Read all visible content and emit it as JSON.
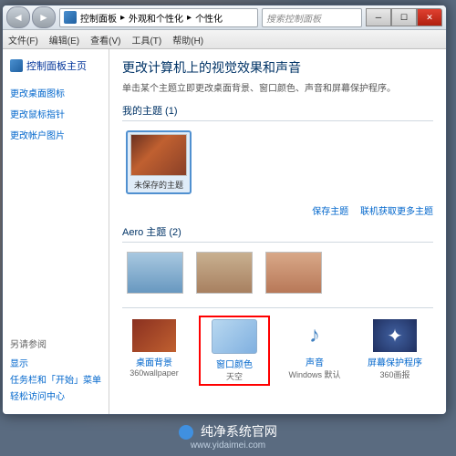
{
  "titlebar": {
    "breadcrumb": [
      "控制面板",
      "外观和个性化",
      "个性化"
    ],
    "search_placeholder": "搜索控制面板"
  },
  "menu": [
    "文件(F)",
    "编辑(E)",
    "查看(V)",
    "工具(T)",
    "帮助(H)"
  ],
  "sidebar": {
    "home": "控制面板主页",
    "links": [
      "更改桌面图标",
      "更改鼠标指针",
      "更改帐户图片"
    ],
    "footer_title": "另请参阅",
    "footer_links": [
      "显示",
      "任务栏和「开始」菜单",
      "轻松访问中心"
    ]
  },
  "main": {
    "title": "更改计算机上的视觉效果和声音",
    "subtitle": "单击某个主题立即更改桌面背景、窗口颜色、声音和屏幕保护程序。",
    "section1": "我的主题 (1)",
    "theme_unsaved": "未保存的主题",
    "save_theme": "保存主题",
    "get_more": "联机获取更多主题",
    "section2": "Aero 主题 (2)"
  },
  "bottom": {
    "bg": {
      "label": "桌面背景",
      "sub": "360wallpaper"
    },
    "color": {
      "label": "窗口颜色",
      "sub": "天空"
    },
    "sound": {
      "label": "声音",
      "sub": "Windows 默认"
    },
    "saver": {
      "label": "屏幕保护程序",
      "sub": "360画报"
    }
  },
  "watermark": {
    "text": "纯净系统官网",
    "url": "www.yidaimei.com"
  }
}
